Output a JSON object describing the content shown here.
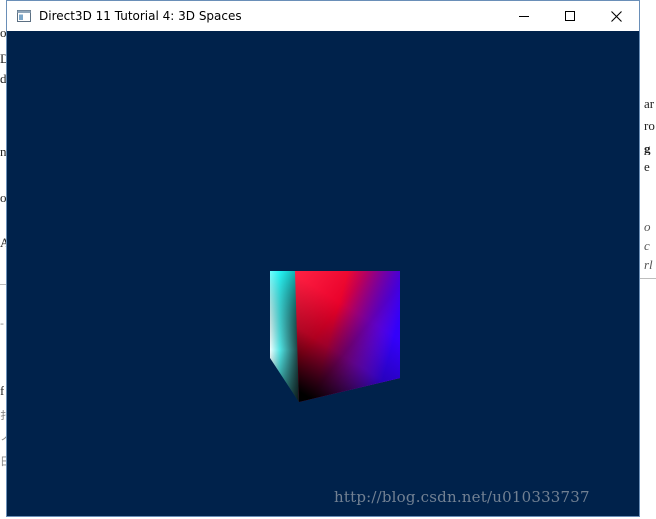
{
  "window": {
    "title": "Direct3D 11 Tutorial 4: 3D Spaces",
    "background_color": "#00224b",
    "icons": {
      "app": "app-window-icon",
      "minimize": "minimize-icon",
      "maximize": "maximize-icon",
      "close": "close-icon"
    }
  },
  "scene": {
    "object": "rotating-cube",
    "face_colors": [
      "#00ffff",
      "#ff0000",
      "#0000ff",
      "#ff00ff",
      "#000000",
      "#ffffff"
    ]
  },
  "background_document": {
    "left_fragments": [
      "o",
      "D",
      "d",
      "n",
      "o",
      "Al",
      "-",
      "f",
      "扌",
      "ノ",
      "日"
    ],
    "right_fragments": [
      "ar",
      "ro",
      "g",
      "e",
      "o",
      "c",
      "rl"
    ]
  },
  "watermark": "http://blog.csdn.net/u010333737"
}
